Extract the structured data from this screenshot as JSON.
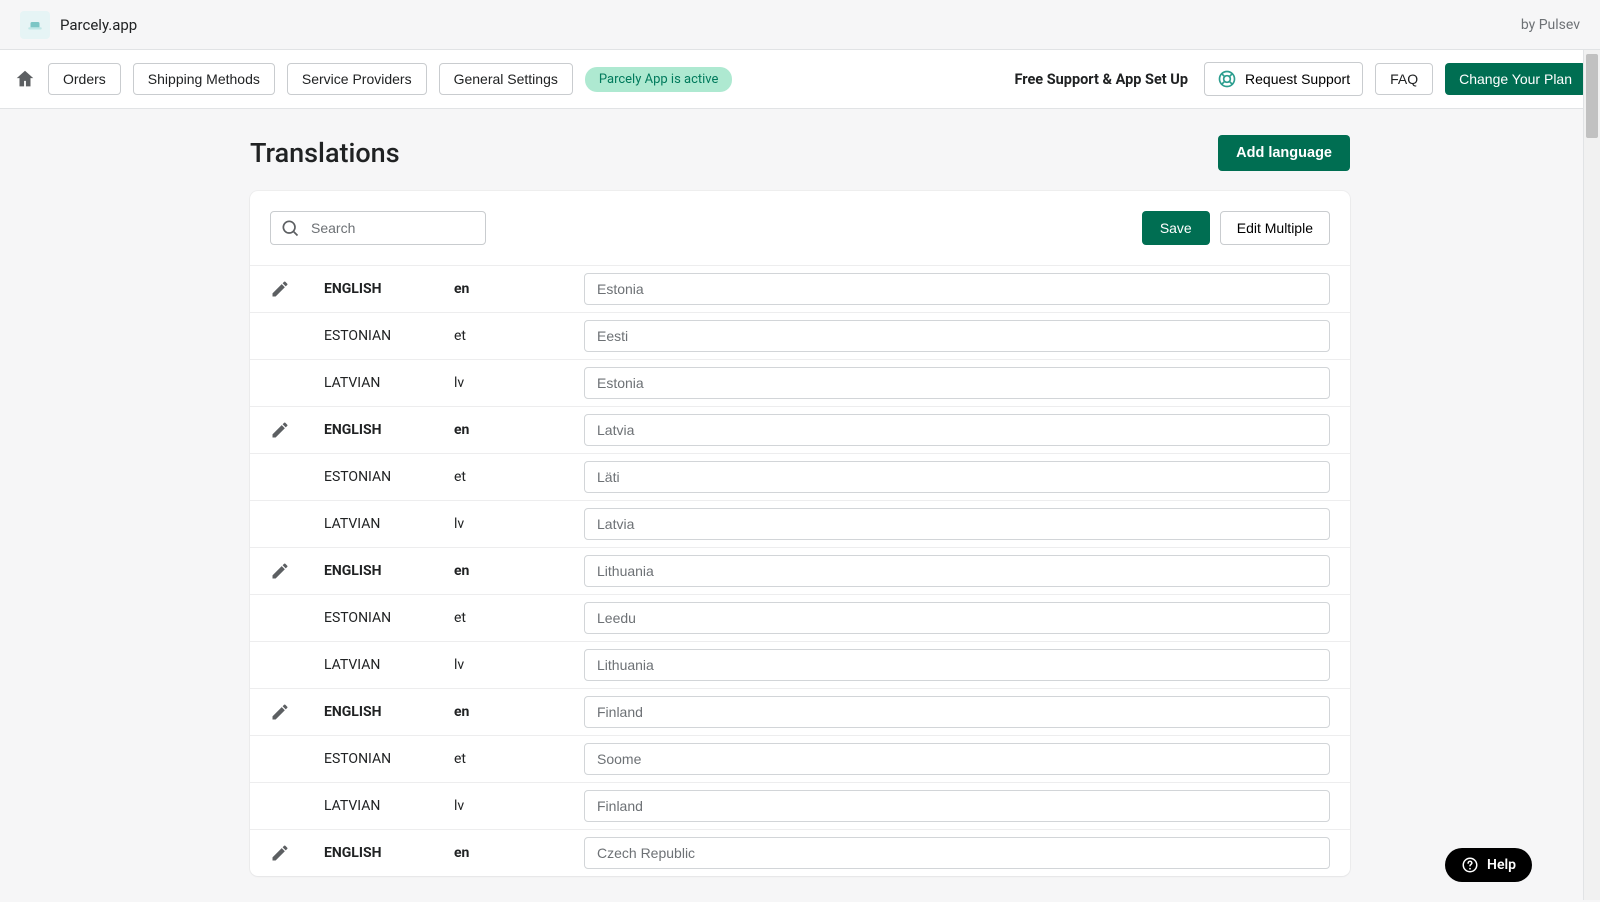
{
  "topbar": {
    "title": "Parcely.app",
    "by": "by Pulsev"
  },
  "nav": {
    "orders": "Orders",
    "shipping": "Shipping Methods",
    "providers": "Service Providers",
    "general": "General Settings",
    "status": "Parcely App is active",
    "support_text": "Free Support & App Set Up",
    "request_support": "Request Support",
    "faq": "FAQ",
    "change_plan": "Change Your Plan"
  },
  "page": {
    "title": "Translations",
    "add_language": "Add language",
    "search_placeholder": "Search",
    "save": "Save",
    "edit_multiple": "Edit Multiple"
  },
  "rows": [
    {
      "lang": "ENGLISH",
      "code": "en",
      "val": "Estonia",
      "bold": true,
      "edit": true
    },
    {
      "lang": "ESTONIAN",
      "code": "et",
      "val": "Eesti",
      "bold": false,
      "edit": false
    },
    {
      "lang": "LATVIAN",
      "code": "lv",
      "val": "Estonia",
      "bold": false,
      "edit": false
    },
    {
      "lang": "ENGLISH",
      "code": "en",
      "val": "Latvia",
      "bold": true,
      "edit": true
    },
    {
      "lang": "ESTONIAN",
      "code": "et",
      "val": "Läti",
      "bold": false,
      "edit": false
    },
    {
      "lang": "LATVIAN",
      "code": "lv",
      "val": "Latvia",
      "bold": false,
      "edit": false
    },
    {
      "lang": "ENGLISH",
      "code": "en",
      "val": "Lithuania",
      "bold": true,
      "edit": true
    },
    {
      "lang": "ESTONIAN",
      "code": "et",
      "val": "Leedu",
      "bold": false,
      "edit": false
    },
    {
      "lang": "LATVIAN",
      "code": "lv",
      "val": "Lithuania",
      "bold": false,
      "edit": false
    },
    {
      "lang": "ENGLISH",
      "code": "en",
      "val": "Finland",
      "bold": true,
      "edit": true
    },
    {
      "lang": "ESTONIAN",
      "code": "et",
      "val": "Soome",
      "bold": false,
      "edit": false
    },
    {
      "lang": "LATVIAN",
      "code": "lv",
      "val": "Finland",
      "bold": false,
      "edit": false
    },
    {
      "lang": "ENGLISH",
      "code": "en",
      "val": "Czech Republic",
      "bold": true,
      "edit": true
    }
  ],
  "help": {
    "label": "Help"
  }
}
